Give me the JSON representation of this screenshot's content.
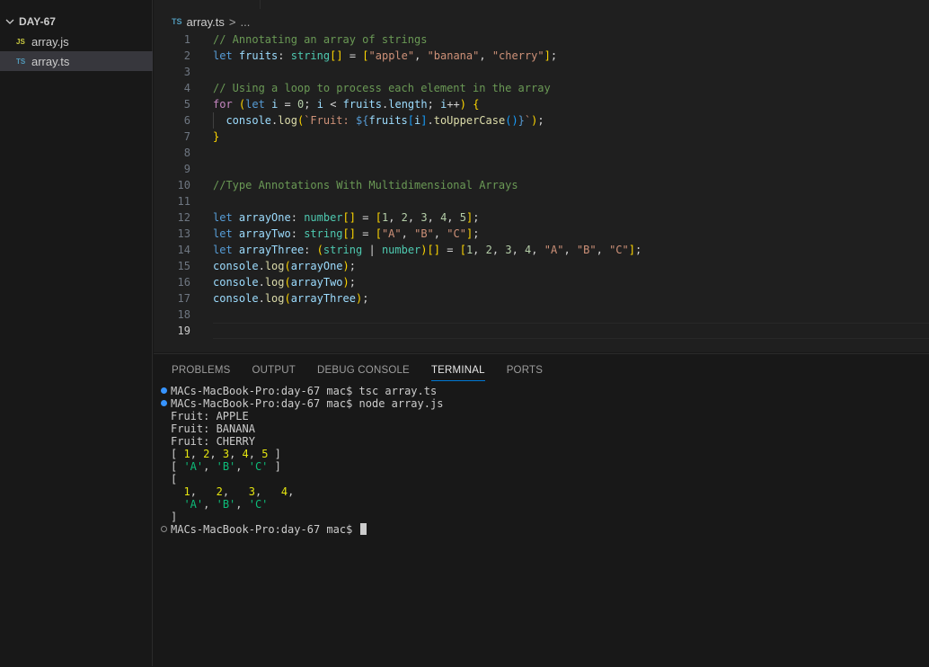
{
  "explorer": {
    "folder": "DAY-67",
    "files": [
      {
        "badge": "JS",
        "name": "array.js"
      },
      {
        "badge": "TS",
        "name": "array.ts"
      }
    ]
  },
  "breadcrumb": {
    "badge": "TS",
    "file": "array.ts",
    "separator": ">",
    "more": "..."
  },
  "code": {
    "line_numbers": [
      "1",
      "2",
      "3",
      "4",
      "5",
      "6",
      "7",
      "8",
      "9",
      "10",
      "11",
      "12",
      "13",
      "14",
      "15",
      "16",
      "17",
      "18",
      "19"
    ],
    "lines": [
      "// Annotating an array of strings",
      "let fruits: string[] = [\"apple\", \"banana\", \"cherry\"];",
      "",
      "// Using a loop to process each element in the array",
      "for (let i = 0; i < fruits.length; i++) {",
      "  console.log(`Fruit: ${fruits[i].toUpperCase()}`);",
      "}",
      "",
      "",
      "//Type Annotations With Multidimensional Arrays",
      "",
      "let arrayOne: number[] = [1, 2, 3, 4, 5];",
      "let arrayTwo: string[] = [\"A\", \"B\", \"C\"];",
      "let arrayThree: (string | number)[] = [1, 2, 3, 4, \"A\", \"B\", \"C\"];",
      "console.log(arrayOne);",
      "console.log(arrayTwo);",
      "console.log(arrayThree);",
      "",
      ""
    ]
  },
  "panel": {
    "tabs": [
      "PROBLEMS",
      "OUTPUT",
      "DEBUG CONSOLE",
      "TERMINAL",
      "PORTS"
    ],
    "active_tab": "TERMINAL"
  },
  "terminal": {
    "prompt": "MACs-MacBook-Pro:day-67 mac$",
    "lines": [
      "MACs-MacBook-Pro:day-67 mac$ tsc array.ts",
      "MACs-MacBook-Pro:day-67 mac$ node array.js",
      "Fruit: APPLE",
      "Fruit: BANANA",
      "Fruit: CHERRY",
      "[ 1, 2, 3, 4, 5 ]",
      "[ 'A', 'B', 'C' ]",
      "[",
      "  1,   2,   3,   4,",
      "  'A', 'B', 'C'",
      "]",
      "MACs-MacBook-Pro:day-67 mac$ "
    ]
  },
  "colors": {
    "accent": "#0078d4",
    "terminal_number": "#e5e510",
    "terminal_string": "#0dbc79",
    "decoration_success": "#3794ff"
  }
}
